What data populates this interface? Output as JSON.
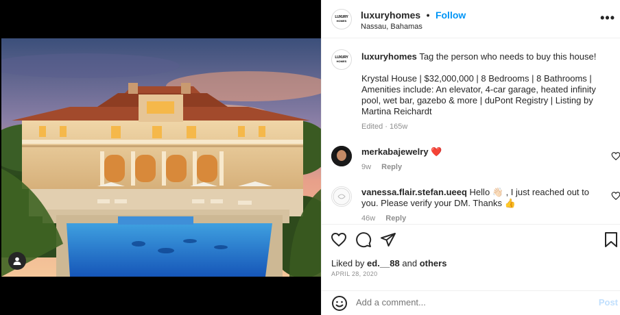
{
  "post": {
    "username": "luxuryhomes",
    "follow_label": "Follow",
    "separator": "•",
    "location": "Nassau, Bahamas",
    "logo_top": "LUXURY",
    "logo_bottom": "HOMES",
    "more_label": "•••"
  },
  "caption": {
    "username": "luxuryhomes",
    "line1": "Tag the person who needs to buy this house!",
    "line2": "Krystal House | $32,000,000 | 8 Bedrooms | 8 Bathrooms | Amenities include: An elevator, 4-car garage, heated infinity pool, wet bar, gazebo & more | duPont Registry | Listing by Martina Reichardt",
    "edited": "Edited · 165w"
  },
  "comments": [
    {
      "username": "merkabajewelry",
      "text": "❤️",
      "age": "9w",
      "reply": "Reply"
    },
    {
      "username": "vanessa.flair.stefan.ueeq",
      "text": "Hello 👋🏻 , I just reached out to you. Please verify your DM. Thanks 👍",
      "age": "46w",
      "reply": "Reply"
    }
  ],
  "actions": {
    "liked_prefix": "Liked by",
    "liked_user": "ed.__88",
    "liked_and": "and",
    "liked_others": "others",
    "date": "APRIL 28, 2020"
  },
  "composer": {
    "placeholder": "Add a comment...",
    "post_label": "Post"
  },
  "icons": [
    "user-tag-icon",
    "more-icon",
    "heart-icon",
    "comment-icon",
    "share-icon",
    "bookmark-icon",
    "emoji-icon",
    "small-heart-icon"
  ],
  "colors": {
    "link": "#0095f6",
    "like_red": "#ed4956",
    "muted": "#8e8e8e",
    "post_disabled": "#c0dffd"
  }
}
